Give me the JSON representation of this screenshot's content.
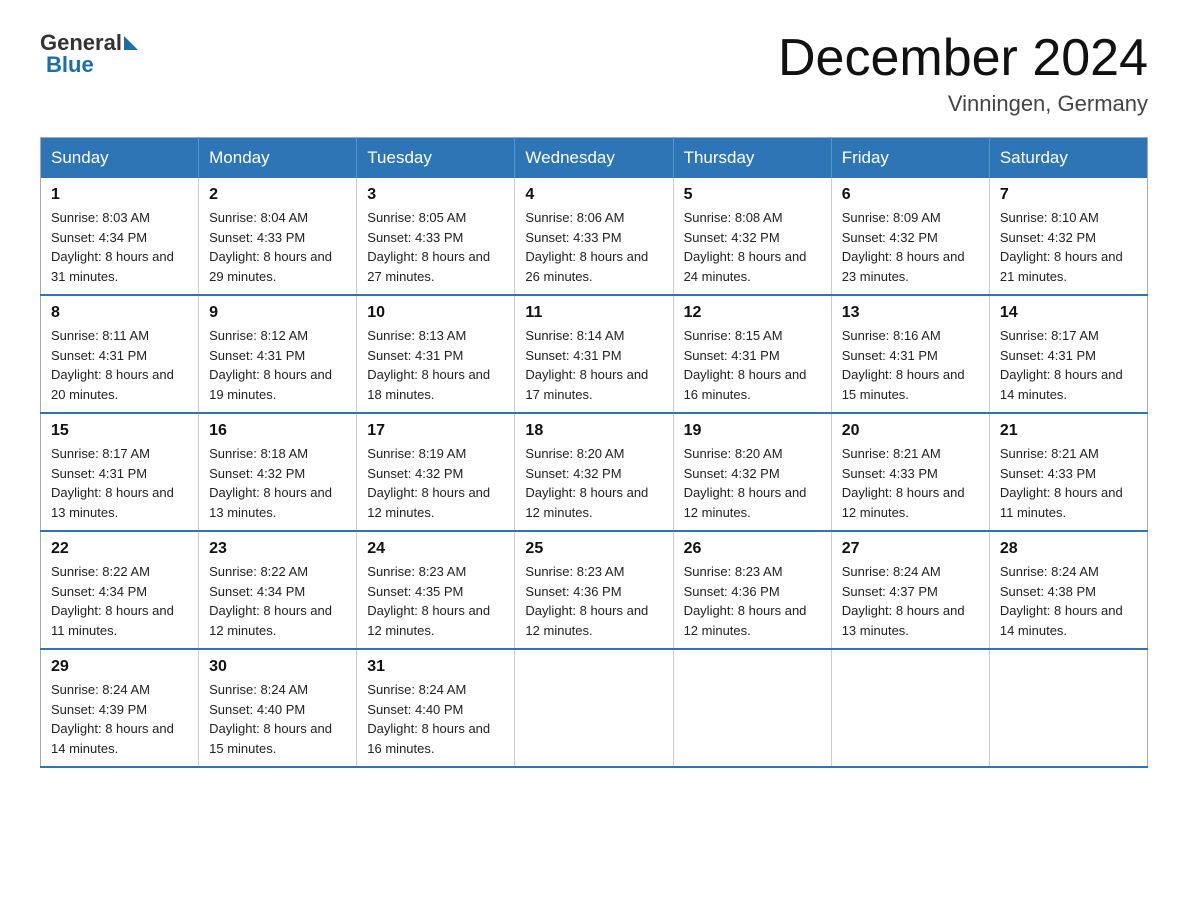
{
  "header": {
    "logo_general": "General",
    "logo_blue": "Blue",
    "title": "December 2024",
    "subtitle": "Vinningen, Germany"
  },
  "days_of_week": [
    "Sunday",
    "Monday",
    "Tuesday",
    "Wednesday",
    "Thursday",
    "Friday",
    "Saturday"
  ],
  "weeks": [
    [
      {
        "day": 1,
        "sunrise": "8:03 AM",
        "sunset": "4:34 PM",
        "daylight": "8 hours and 31 minutes."
      },
      {
        "day": 2,
        "sunrise": "8:04 AM",
        "sunset": "4:33 PM",
        "daylight": "8 hours and 29 minutes."
      },
      {
        "day": 3,
        "sunrise": "8:05 AM",
        "sunset": "4:33 PM",
        "daylight": "8 hours and 27 minutes."
      },
      {
        "day": 4,
        "sunrise": "8:06 AM",
        "sunset": "4:33 PM",
        "daylight": "8 hours and 26 minutes."
      },
      {
        "day": 5,
        "sunrise": "8:08 AM",
        "sunset": "4:32 PM",
        "daylight": "8 hours and 24 minutes."
      },
      {
        "day": 6,
        "sunrise": "8:09 AM",
        "sunset": "4:32 PM",
        "daylight": "8 hours and 23 minutes."
      },
      {
        "day": 7,
        "sunrise": "8:10 AM",
        "sunset": "4:32 PM",
        "daylight": "8 hours and 21 minutes."
      }
    ],
    [
      {
        "day": 8,
        "sunrise": "8:11 AM",
        "sunset": "4:31 PM",
        "daylight": "8 hours and 20 minutes."
      },
      {
        "day": 9,
        "sunrise": "8:12 AM",
        "sunset": "4:31 PM",
        "daylight": "8 hours and 19 minutes."
      },
      {
        "day": 10,
        "sunrise": "8:13 AM",
        "sunset": "4:31 PM",
        "daylight": "8 hours and 18 minutes."
      },
      {
        "day": 11,
        "sunrise": "8:14 AM",
        "sunset": "4:31 PM",
        "daylight": "8 hours and 17 minutes."
      },
      {
        "day": 12,
        "sunrise": "8:15 AM",
        "sunset": "4:31 PM",
        "daylight": "8 hours and 16 minutes."
      },
      {
        "day": 13,
        "sunrise": "8:16 AM",
        "sunset": "4:31 PM",
        "daylight": "8 hours and 15 minutes."
      },
      {
        "day": 14,
        "sunrise": "8:17 AM",
        "sunset": "4:31 PM",
        "daylight": "8 hours and 14 minutes."
      }
    ],
    [
      {
        "day": 15,
        "sunrise": "8:17 AM",
        "sunset": "4:31 PM",
        "daylight": "8 hours and 13 minutes."
      },
      {
        "day": 16,
        "sunrise": "8:18 AM",
        "sunset": "4:32 PM",
        "daylight": "8 hours and 13 minutes."
      },
      {
        "day": 17,
        "sunrise": "8:19 AM",
        "sunset": "4:32 PM",
        "daylight": "8 hours and 12 minutes."
      },
      {
        "day": 18,
        "sunrise": "8:20 AM",
        "sunset": "4:32 PM",
        "daylight": "8 hours and 12 minutes."
      },
      {
        "day": 19,
        "sunrise": "8:20 AM",
        "sunset": "4:32 PM",
        "daylight": "8 hours and 12 minutes."
      },
      {
        "day": 20,
        "sunrise": "8:21 AM",
        "sunset": "4:33 PM",
        "daylight": "8 hours and 12 minutes."
      },
      {
        "day": 21,
        "sunrise": "8:21 AM",
        "sunset": "4:33 PM",
        "daylight": "8 hours and 11 minutes."
      }
    ],
    [
      {
        "day": 22,
        "sunrise": "8:22 AM",
        "sunset": "4:34 PM",
        "daylight": "8 hours and 11 minutes."
      },
      {
        "day": 23,
        "sunrise": "8:22 AM",
        "sunset": "4:34 PM",
        "daylight": "8 hours and 12 minutes."
      },
      {
        "day": 24,
        "sunrise": "8:23 AM",
        "sunset": "4:35 PM",
        "daylight": "8 hours and 12 minutes."
      },
      {
        "day": 25,
        "sunrise": "8:23 AM",
        "sunset": "4:36 PM",
        "daylight": "8 hours and 12 minutes."
      },
      {
        "day": 26,
        "sunrise": "8:23 AM",
        "sunset": "4:36 PM",
        "daylight": "8 hours and 12 minutes."
      },
      {
        "day": 27,
        "sunrise": "8:24 AM",
        "sunset": "4:37 PM",
        "daylight": "8 hours and 13 minutes."
      },
      {
        "day": 28,
        "sunrise": "8:24 AM",
        "sunset": "4:38 PM",
        "daylight": "8 hours and 14 minutes."
      }
    ],
    [
      {
        "day": 29,
        "sunrise": "8:24 AM",
        "sunset": "4:39 PM",
        "daylight": "8 hours and 14 minutes."
      },
      {
        "day": 30,
        "sunrise": "8:24 AM",
        "sunset": "4:40 PM",
        "daylight": "8 hours and 15 minutes."
      },
      {
        "day": 31,
        "sunrise": "8:24 AM",
        "sunset": "4:40 PM",
        "daylight": "8 hours and 16 minutes."
      },
      null,
      null,
      null,
      null
    ]
  ]
}
